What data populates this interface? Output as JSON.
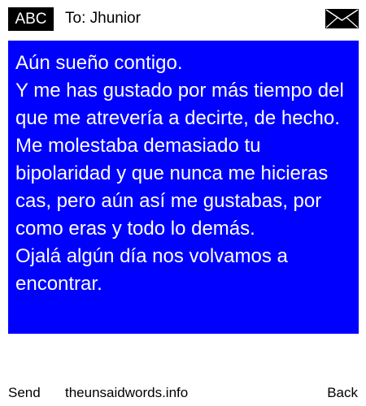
{
  "header": {
    "mode_badge": "ABC",
    "recipient": "To: Jhunior",
    "envelope_icon": "envelope-icon"
  },
  "message": {
    "body": "Aún sueño contigo.\nY me has gustado por más tiempo del que me atrevería a decirte, de hecho.\nMe molestaba demasiado tu bipolaridad y que nunca me hicieras cas, pero aún así me gustabas, por como eras y todo lo demás.\nOjalá algún día nos volvamos a encontrar."
  },
  "footer": {
    "send_label": "Send",
    "site_label": "theunsaidwords.info",
    "back_label": "Back"
  },
  "colors": {
    "panel_background": "#0000ff",
    "panel_text": "#ffffff",
    "badge_background": "#000000",
    "badge_text": "#ffffff"
  }
}
